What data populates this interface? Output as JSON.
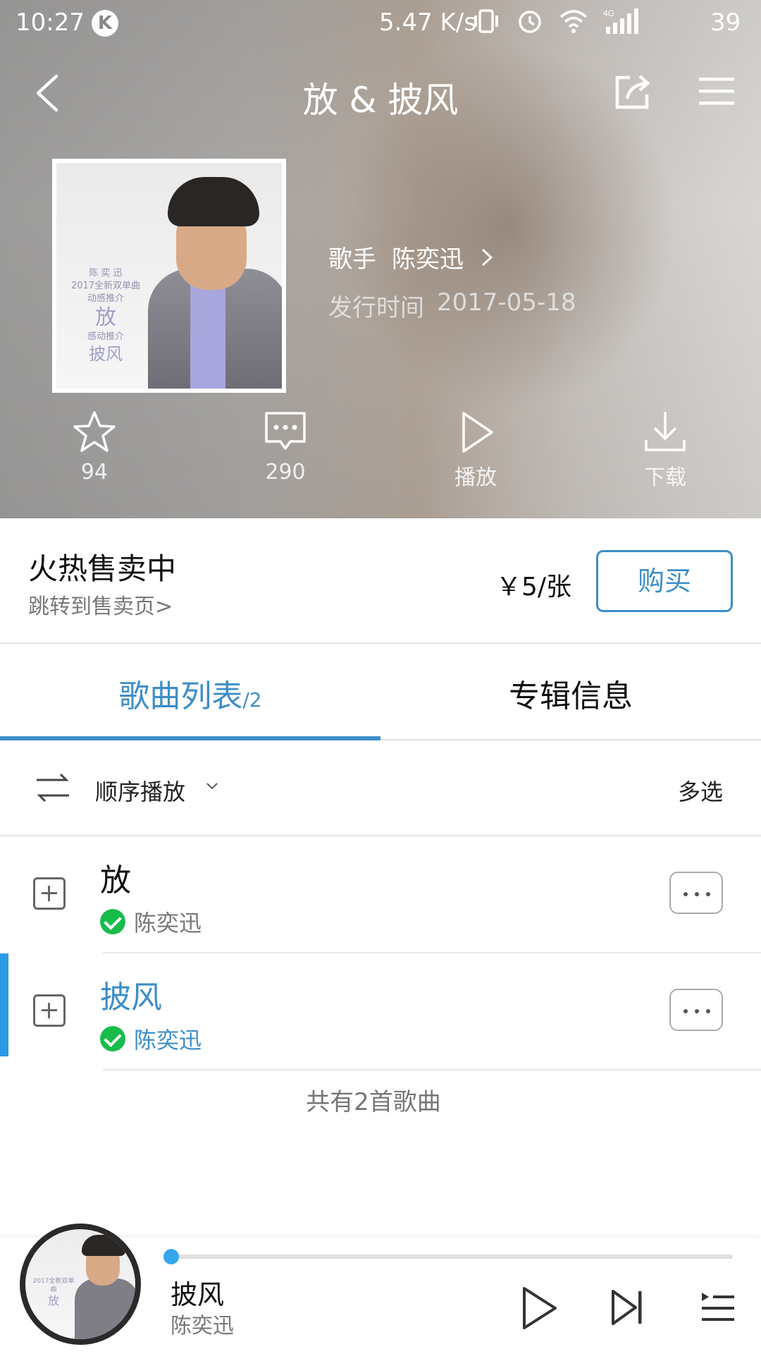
{
  "status_bar": {
    "time": "10:27",
    "k_badge": "K",
    "net_speed": "5.47 K/s",
    "battery": "39",
    "icons": [
      "vibrate-icon",
      "alarm-icon",
      "wifi-icon",
      "signal-4g-icon"
    ]
  },
  "header": {
    "title": "放 & 披风",
    "back_icon": "back-arrow-icon",
    "share_icon": "share-icon",
    "menu_icon": "menu-icon"
  },
  "album": {
    "cover_text": {
      "artist": "陈  奕  迅",
      "subtitle": "2017全新双单曲",
      "tag1": "动感推介",
      "song1": "放",
      "tag2": "感动推介",
      "song2": "披风"
    },
    "singer_label": "歌手",
    "singer": "陈奕迅",
    "release_label": "发行时间",
    "release_date": "2017-05-18"
  },
  "actions": [
    {
      "icon": "star-icon",
      "label": "94"
    },
    {
      "icon": "comment-icon",
      "label": "290"
    },
    {
      "icon": "play-icon",
      "label": "播放"
    },
    {
      "icon": "download-icon",
      "label": "下载"
    }
  ],
  "sale": {
    "headline": "火热售卖中",
    "link": "跳转到售卖页>",
    "price": "￥5/张",
    "buy_label": "购买"
  },
  "tabs": {
    "song_list": "歌曲列表",
    "song_count": "/2",
    "album_info": "专辑信息"
  },
  "play_mode": {
    "label": "顺序播放",
    "multi_select": "多选"
  },
  "songs": [
    {
      "title": "放",
      "artist": "陈奕迅",
      "playing": false
    },
    {
      "title": "披风",
      "artist": "陈奕迅",
      "playing": true
    }
  ],
  "total_text": "共有2首歌曲",
  "colors": {
    "accent": "#3d8ec7",
    "downloaded": "#17bc4a",
    "progress_dot": "#35a6ec"
  },
  "mini_player": {
    "title": "披风",
    "artist": "陈奕迅",
    "progress": 0.0
  }
}
